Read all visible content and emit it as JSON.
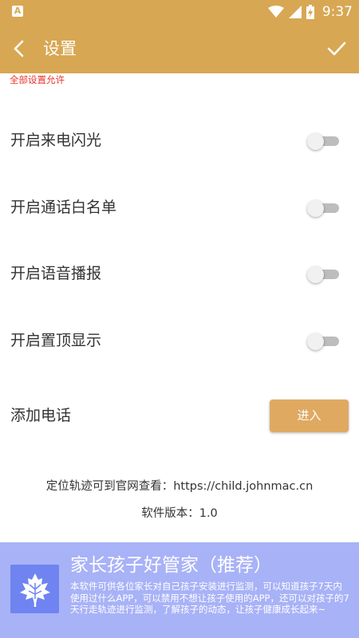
{
  "status_bar": {
    "app_icon_letter": "A",
    "time": "9:37",
    "icons": [
      "wifi-icon",
      "signal-icon",
      "battery-charging-icon"
    ]
  },
  "app_bar": {
    "title": "设置",
    "back_icon": "chevron-left-icon",
    "confirm_icon": "check-icon"
  },
  "notice": "全部设置允许",
  "settings": [
    {
      "label": "开启来电闪光",
      "enabled": false
    },
    {
      "label": "开启通话白名单",
      "enabled": false
    },
    {
      "label": "开启语音播报",
      "enabled": false
    },
    {
      "label": "开启置顶显示",
      "enabled": false
    }
  ],
  "add_phone": {
    "label": "添加电话",
    "button_label": "进入"
  },
  "footer": {
    "website_line": "定位轨迹可到官网查看：https://child.johnmac.cn",
    "version_line": "软件版本：1.0"
  },
  "banner": {
    "title": "家长孩子好管家（推荐）",
    "description": "本软件可供各位家长对自己孩子安装进行监测，可以知道孩子7天内使用过什么APP，可以禁用不想让孩子使用的APP，还可以对孩子的7天行走轨迹进行监测，了解孩子的动态，让孩子健康成长起来~",
    "logo_icon": "maple-leaf-icon"
  },
  "colors": {
    "accent": "#d8a753",
    "button": "#dfa962",
    "notice": "#e8332a",
    "banner_bg": "#a8b2f7",
    "banner_logo_bg": "#6f84f0",
    "switch_off_track": "#bdbdbd"
  }
}
